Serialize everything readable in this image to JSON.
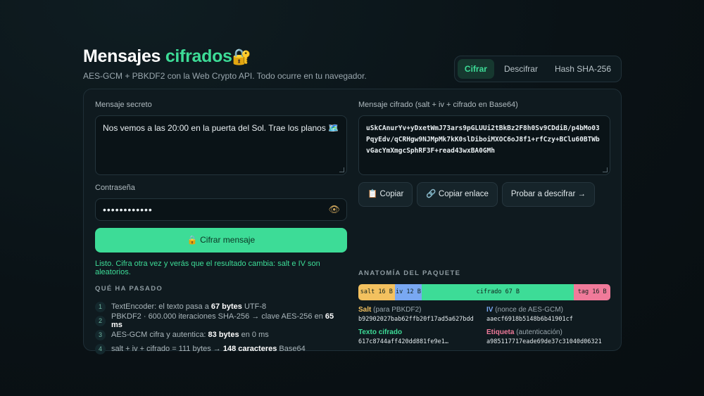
{
  "header": {
    "title_main": "Mensajes ",
    "title_accent": "cifrados",
    "title_emoji": "🔐",
    "subtitle": "AES-GCM + PBKDF2 con la Web Crypto API. Todo ocurre en tu navegador."
  },
  "tabs": [
    {
      "label": "Cifrar",
      "active": true
    },
    {
      "label": "Descifrar",
      "active": false
    },
    {
      "label": "Hash SHA-256",
      "active": false
    }
  ],
  "left": {
    "message_label": "Mensaje secreto",
    "message_value": "Nos vemos a las 20:00 en la puerta del Sol. Trae los planos 🗺️",
    "password_label": "Contraseña",
    "password_value": "••••••••••••",
    "eye_icon": "👁",
    "encrypt_button": "🔒 Cifrar mensaje",
    "status": "Listo. Cifra otra vez y verás que el resultado cambia: salt e IV son aleatorios.",
    "steps_title": "QUÉ HA PASADO",
    "steps": [
      {
        "num": "1",
        "pre": "TextEncoder: el texto pasa a ",
        "bold": "67 bytes",
        "post": " UTF-8",
        "bold2": "",
        "post2": ""
      },
      {
        "num": "2",
        "pre": "PBKDF2 · 600.000 iteraciones SHA-256 → clave AES-256 en ",
        "bold": "65 ms",
        "post": "",
        "bold2": "",
        "post2": ""
      },
      {
        "num": "3",
        "pre": "AES-GCM cifra y autentica: ",
        "bold": "83 bytes",
        "post": " en 0 ms",
        "bold2": "",
        "post2": ""
      },
      {
        "num": "4",
        "pre": "salt + iv + cifrado = 111 bytes → ",
        "bold": "148 caracteres",
        "post": " Base64",
        "bold2": "",
        "post2": ""
      }
    ]
  },
  "right": {
    "cipher_label": "Mensaje cifrado (salt + iv + cifrado en Base64)",
    "cipher_value": "uSkCAnurYv+yDxetWmJ73ars9pGLUUi2tBkBz2F8h0Sv9CDdiB/p4bMo03PqyEdv/qCRHgw9NJMpMk7kK0slDiboiMXOC6oJ8f1+rfCzy+BClu60BTWbvGacYmXmgcSphRF3F+read43wxBA0GMh",
    "buttons": {
      "copy": "📋 Copiar",
      "copy_link": "🔗 Copiar enlace",
      "try_decrypt": "Probar a descifrar →"
    },
    "anatomy_title": "ANATOMÍA DEL PAQUETE",
    "bar": {
      "salt": "salt 16 B",
      "iv": "iv 12 B",
      "ct": "cifrado 67 B",
      "tag": "tag 16 B"
    },
    "legend": {
      "salt_name": "Salt",
      "salt_note": " (para PBKDF2)",
      "salt_value": "b92902027bab62ffb20f17ad5a627bdd",
      "iv_name": "IV",
      "iv_note": " (nonce de AES-GCM)",
      "iv_value": "aaecf6918b5148b6b41901cf",
      "ct_name": "Texto cifrado",
      "ct_note": "",
      "ct_value": "617c8744aff420dd881fe9e1…",
      "tag_name": "Etiqueta",
      "tag_note": " (autenticación)",
      "tag_value": "a985117717eade69de37c31040d06321"
    }
  },
  "colors": {
    "accent": "#3ddc97",
    "salt": "#f3c15f",
    "iv": "#79a8f2",
    "tag": "#f07a9a"
  }
}
